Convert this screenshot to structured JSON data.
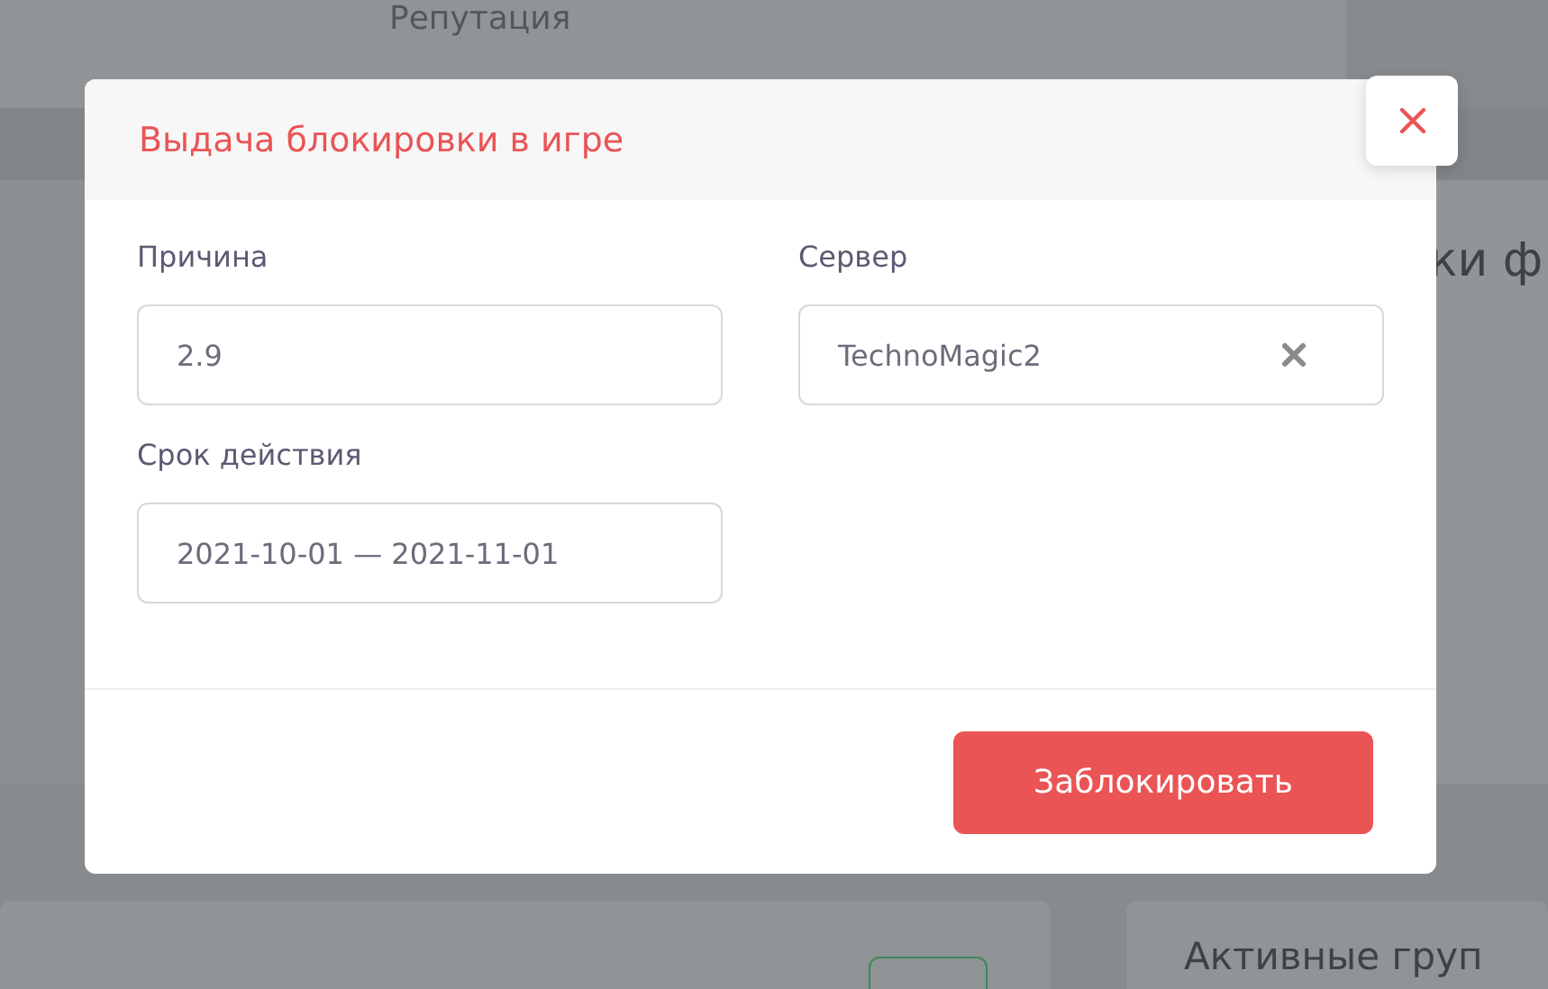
{
  "background": {
    "top_card_title": "Репутация",
    "right_card_title": "ки ф",
    "bottom_card_title": "Активные груп"
  },
  "modal": {
    "title": "Выдача блокировки в игре",
    "fields": [
      {
        "label": "Причина",
        "value": "2.9",
        "clearable": false
      },
      {
        "label": "Сервер",
        "value": "TechnoMagic2",
        "clearable": true
      },
      {
        "label": "Срок действия",
        "value": "2021-10-01 — 2021-11-01",
        "clearable": false
      }
    ],
    "submit_button": "Заблокировать"
  }
}
